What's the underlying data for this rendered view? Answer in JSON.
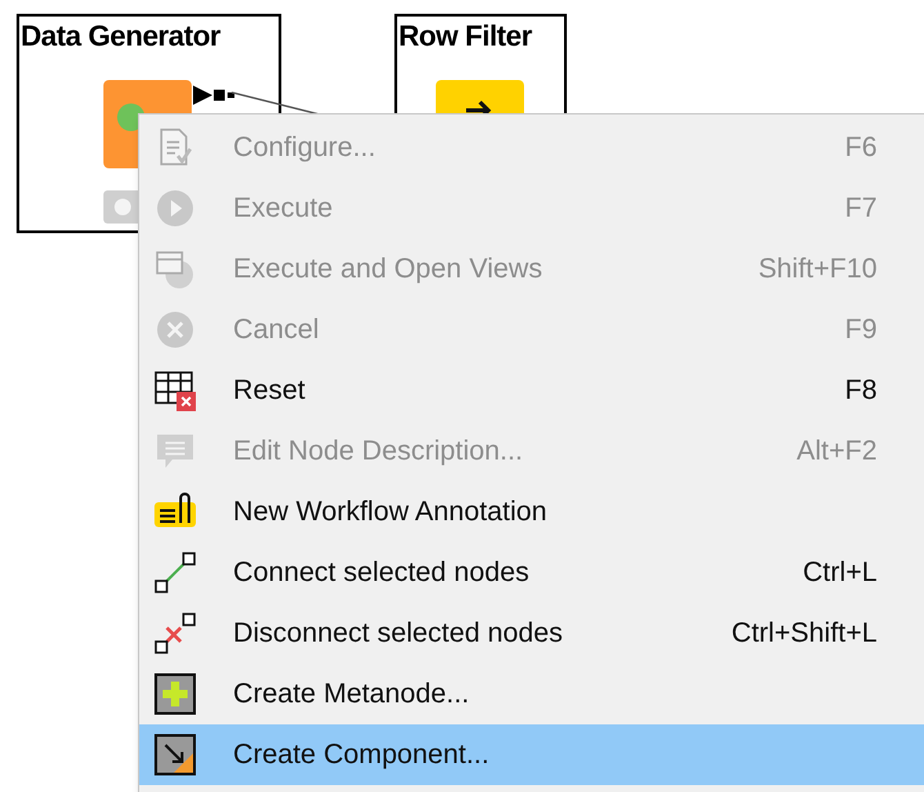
{
  "nodes": [
    {
      "title": "Data Generator",
      "kind": "generator"
    },
    {
      "title": "Row Filter",
      "kind": "filter"
    }
  ],
  "context_menu": {
    "items": [
      {
        "kind": "configure",
        "label": "Configure...",
        "shortcut": "F6",
        "disabled": true,
        "selected": false
      },
      {
        "kind": "execute",
        "label": "Execute",
        "shortcut": "F7",
        "disabled": true,
        "selected": false
      },
      {
        "kind": "views",
        "label": "Execute and Open Views",
        "shortcut": "Shift+F10",
        "disabled": true,
        "selected": false
      },
      {
        "kind": "cancel",
        "label": "Cancel",
        "shortcut": "F9",
        "disabled": true,
        "selected": false
      },
      {
        "kind": "reset",
        "label": "Reset",
        "shortcut": "F8",
        "disabled": false,
        "selected": false
      },
      {
        "kind": "description",
        "label": "Edit Node Description...",
        "shortcut": "Alt+F2",
        "disabled": true,
        "selected": false
      },
      {
        "kind": "annotation",
        "label": "New Workflow Annotation",
        "disabled": false,
        "selected": false
      },
      {
        "kind": "connect",
        "label": "Connect selected nodes",
        "shortcut": "Ctrl+L",
        "disabled": false,
        "selected": false
      },
      {
        "kind": "disconnect",
        "label": "Disconnect selected nodes",
        "shortcut": "Ctrl+Shift+L",
        "disabled": false,
        "selected": false
      },
      {
        "kind": "metanode",
        "label": "Create Metanode...",
        "disabled": false,
        "selected": false
      },
      {
        "kind": "component",
        "label": "Create Component...",
        "disabled": false,
        "selected": true
      }
    ]
  }
}
